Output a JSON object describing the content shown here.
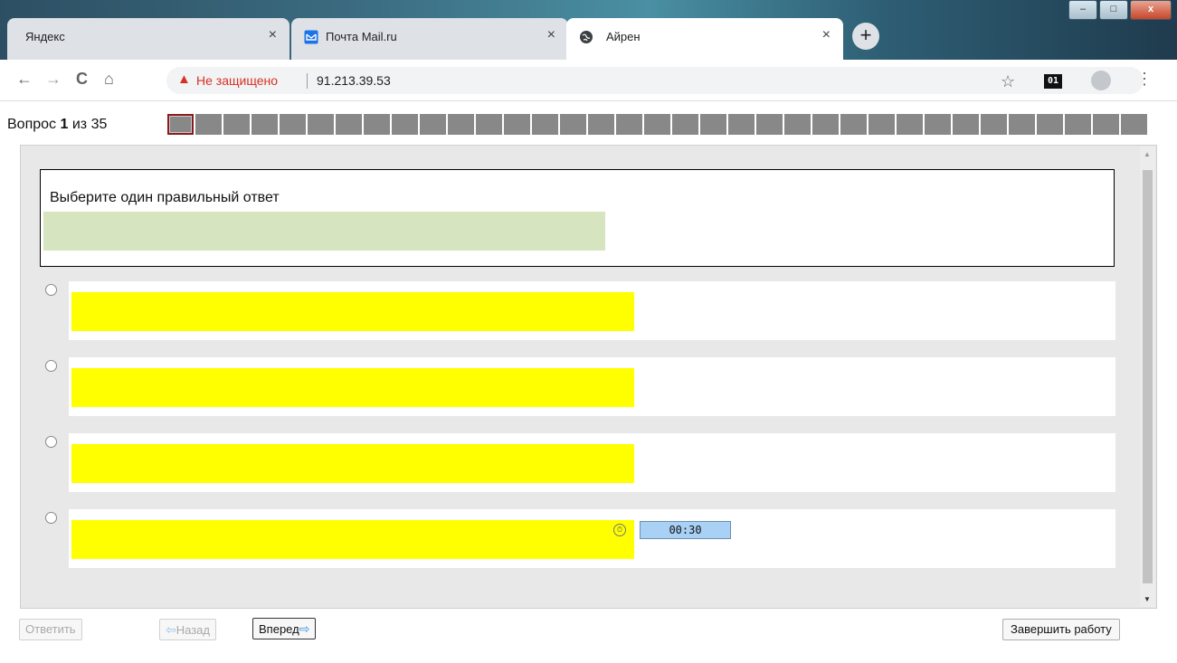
{
  "browser": {
    "tabs": [
      {
        "title": "Яндекс",
        "active": false
      },
      {
        "title": "Почта Mail.ru",
        "active": false
      },
      {
        "title": "Айрен",
        "active": true
      }
    ],
    "tab_close_glyph": "×",
    "new_tab_glyph": "+",
    "window_buttons": {
      "minimize": "–",
      "maximize": "□",
      "close": "x"
    },
    "nav": {
      "back": "←",
      "forward": "→",
      "reload": "C",
      "home": "⌂"
    },
    "address": {
      "security_label": "Не защищено",
      "url": "91.213.39.53"
    },
    "bookmark_glyph": "☆",
    "extension_badge": "01",
    "menu_glyph": "⋮"
  },
  "test": {
    "question_prefix": "Вопрос",
    "question_number": "1",
    "question_of": "из",
    "question_total": "35",
    "question_cells_total": 35,
    "current_cell_index": 0,
    "prompt": "Выберите один правильный ответ",
    "answers_count": 4
  },
  "footer": {
    "answer_button": "Ответить",
    "back_button": "Назад",
    "forward_button": "Вперед",
    "timer": "00:30",
    "finish_button": "Завершить работу"
  },
  "colors": {
    "highlight_yellow": "#ffff00",
    "question_image_green": "#d6e4bf",
    "timer_bg": "#a9d1f5",
    "cell_grey": "#888888",
    "current_cell_border": "#8b1a1a"
  }
}
